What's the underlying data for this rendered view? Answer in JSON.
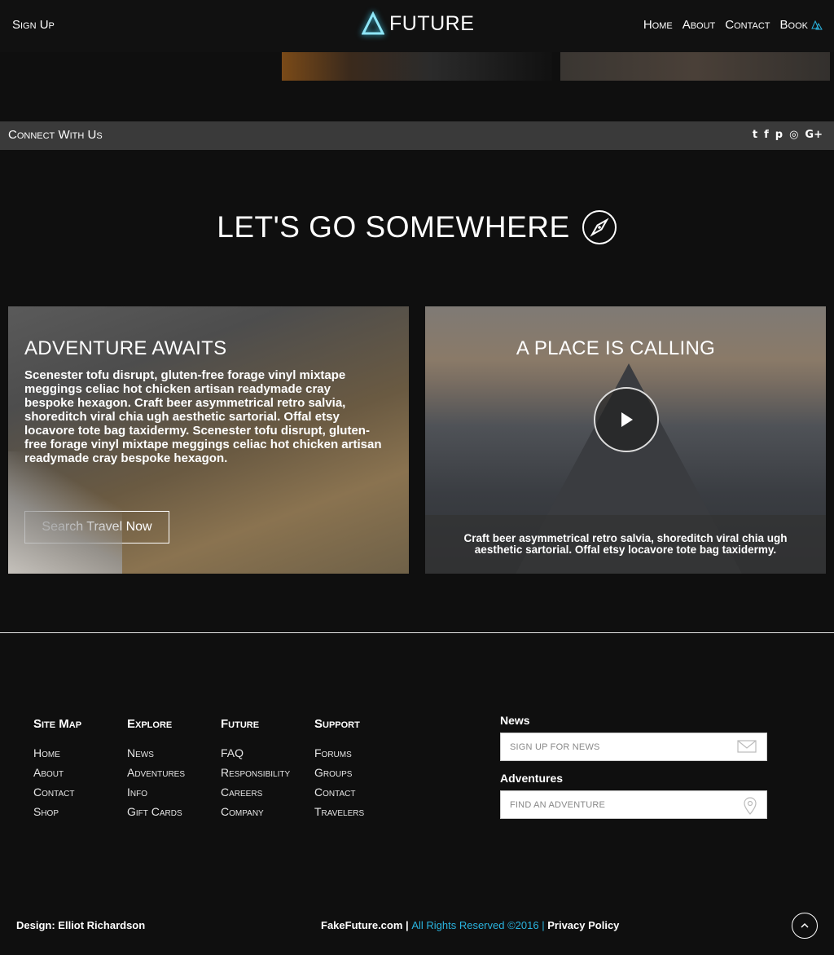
{
  "header": {
    "signup": "Sign Up",
    "brand": "FUTURE",
    "nav": [
      "Home",
      "About",
      "Contact"
    ],
    "book": "Book"
  },
  "connect": {
    "label": "Connect With Us",
    "icons": [
      "twitter-icon",
      "facebook-icon",
      "pinterest-icon",
      "instagram-icon",
      "google-plus-icon"
    ],
    "glyphs": [
      "t",
      "f",
      "p",
      "◎",
      "G+"
    ]
  },
  "section": {
    "title": "LET'S GO SOMEWHERE"
  },
  "card1": {
    "title": "ADVENTURE AWAITS",
    "body": "Scenester tofu disrupt, gluten-free forage vinyl mixtape meggings celiac hot chicken artisan readymade cray bespoke hexagon. Craft beer asymmetrical retro salvia, shoreditch viral chia ugh aesthetic sartorial. Offal etsy locavore tote bag taxidermy. Scenester tofu disrupt, gluten-free forage vinyl mixtape meggings celiac hot chicken artisan readymade cray bespoke hexagon.",
    "button": "Search Travel Now"
  },
  "card2": {
    "title": "A PLACE IS CALLING",
    "caption": "Craft beer asymmetrical retro salvia, shoreditch viral chia ugh aesthetic sartorial. Offal etsy locavore tote bag taxidermy."
  },
  "footer": {
    "columns": [
      {
        "title": "Site Map",
        "items": [
          "Home",
          "About",
          "Contact",
          "Shop"
        ]
      },
      {
        "title": "Explore",
        "items": [
          "News",
          "Adventures",
          "Info",
          "Gift Cards"
        ]
      },
      {
        "title": "Future",
        "items": [
          "FAQ",
          "Responsibility",
          "Careers",
          "Company"
        ]
      },
      {
        "title": "Support",
        "items": [
          "Forums",
          "Groups",
          "Contact",
          "Travelers"
        ]
      }
    ],
    "news_label": "News",
    "news_placeholder": "SIGN UP FOR NEWS",
    "adventures_label": "Adventures",
    "adventures_placeholder": "FIND AN ADVENTURE",
    "design": "Design: Elliot Richardson",
    "site": "FakeFuture.com",
    "sep": "|",
    "rights": "All Rights Reserved ©2016",
    "policy": "Privacy Policy"
  },
  "colors": {
    "accent": "#2ab3de",
    "background": "#0f0f0f",
    "bar": "#3a3a3a"
  }
}
